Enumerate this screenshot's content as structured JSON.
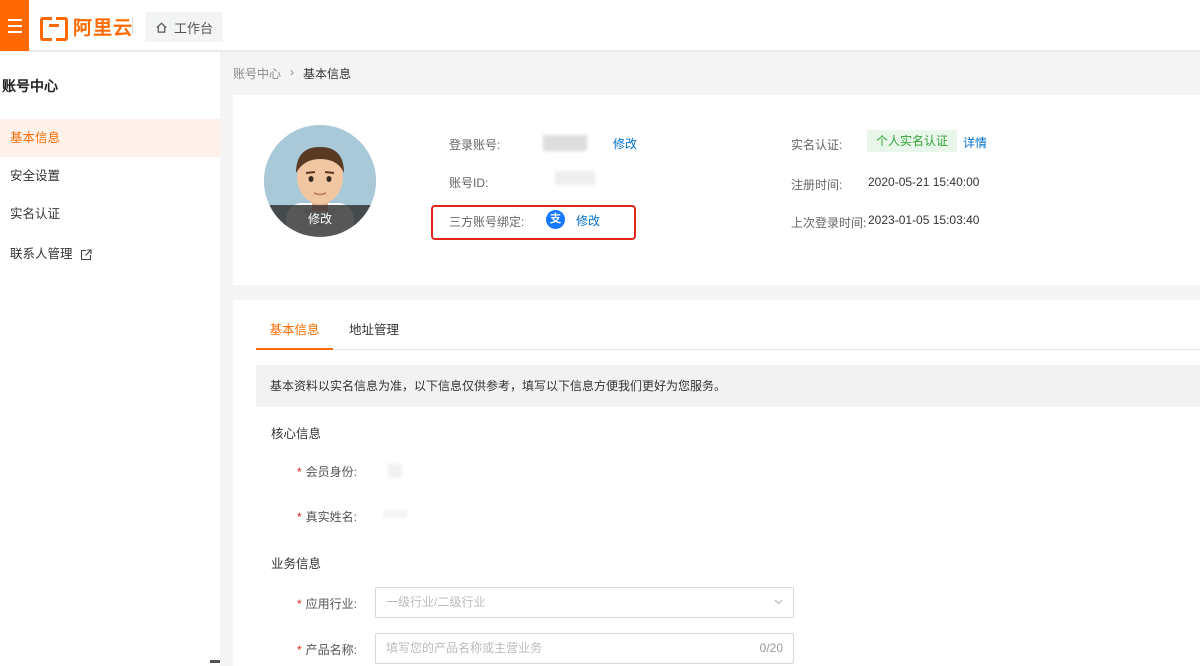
{
  "topbar": {
    "logo_text": "阿里云",
    "workbench_label": "工作台"
  },
  "sidebar": {
    "title": "账号中心",
    "items": [
      {
        "label": "基本信息"
      },
      {
        "label": "安全设置"
      },
      {
        "label": "实名认证"
      },
      {
        "label": "联系人管理"
      }
    ]
  },
  "breadcrumb": {
    "root": "账号中心",
    "separator": "›",
    "current": "基本信息"
  },
  "profile": {
    "avatar_edit": "修改",
    "login_account_label": "登录账号:",
    "login_account_edit": "修改",
    "account_id_label": "账号ID:",
    "third_party_label": "三方账号绑定:",
    "third_party_icon": "支",
    "third_party_edit": "修改",
    "verify_label": "实名认证:",
    "verify_status": "个人实名认证",
    "verify_detail": "详情",
    "register_time_label": "注册时间:",
    "register_time": "2020-05-21 15:40:00",
    "last_login_label": "上次登录时间:",
    "last_login": "2023-01-05 15:03:40"
  },
  "tabs": [
    {
      "label": "基本信息"
    },
    {
      "label": "地址管理"
    }
  ],
  "notice": "基本资料以实名信息为准，以下信息仅供参考，填写以下信息方便我们更好为您服务。",
  "core_section": {
    "title": "核心信息",
    "member_label": "会员身份:",
    "real_name_label": "真实姓名:"
  },
  "business_section": {
    "title": "业务信息",
    "industry_label": "应用行业:",
    "industry_placeholder": "一级行业/二级行业",
    "product_label": "产品名称:",
    "product_placeholder": "填写您的产品名称或主营业务",
    "product_count": "0/20"
  },
  "colors": {
    "brand": "#ff6a00",
    "link": "#0070cc",
    "success": "#31a535",
    "highlight": "#e0251b"
  }
}
